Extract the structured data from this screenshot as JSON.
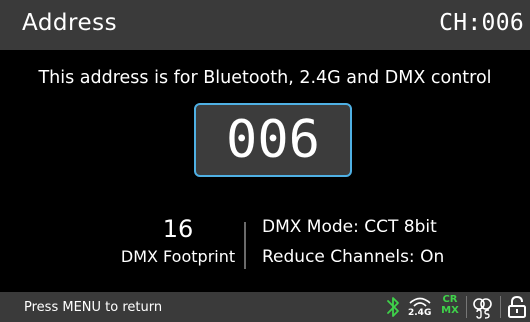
{
  "header": {
    "title": "Address",
    "channel": "CH:006"
  },
  "info_text": "This address is for Bluetooth, 2.4G and DMX control",
  "address_value": "006",
  "footprint": {
    "value": "16",
    "label": "DMX Footprint"
  },
  "dmx_mode": "DMX Mode: CCT 8bit",
  "reduce_channels": "Reduce Channels: On",
  "footer": {
    "hint": "Press MENU to return",
    "wireless_label": "2.4G",
    "crmx_label_top": "CR",
    "crmx_label_bottom": "MX",
    "icons": [
      "bluetooth-icon",
      "wireless-2-4g-icon",
      "crmx-icon",
      "cycle-cs-icon",
      "unlock-icon"
    ]
  },
  "colors": {
    "accent_blue": "#4fb0e4",
    "bluetooth_green": "#3fd24a",
    "crmx_green": "#3fd24a"
  }
}
